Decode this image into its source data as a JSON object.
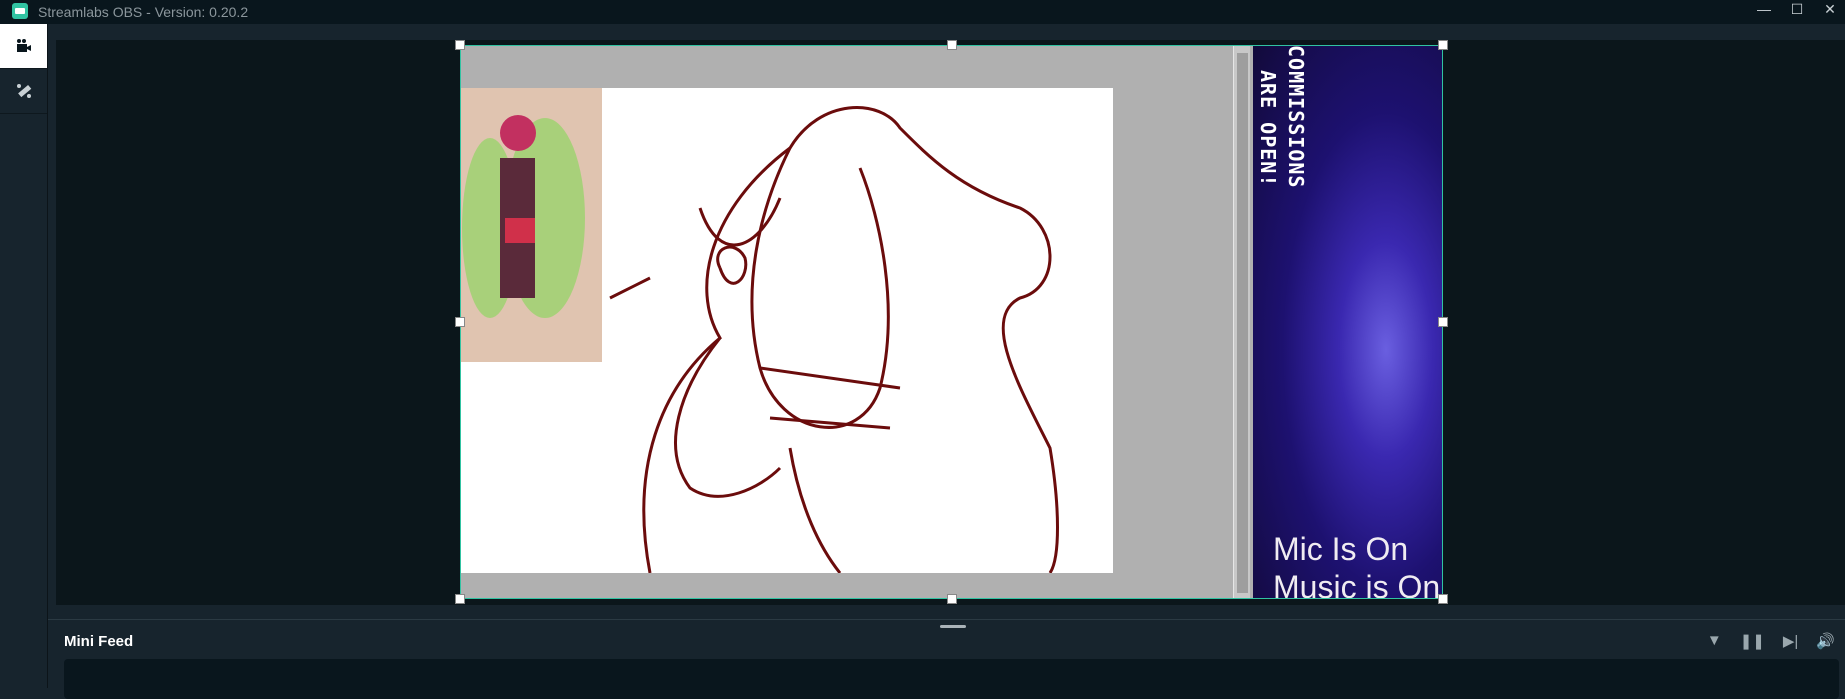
{
  "window": {
    "title": "Streamlabs OBS - Version: 0.20.2",
    "minimize": "—",
    "maximize": "☐",
    "close": "✕"
  },
  "sidebar": {
    "items": [
      {
        "name": "studio-icon",
        "active": true
      },
      {
        "name": "themes-icon",
        "active": false
      }
    ]
  },
  "preview": {
    "overlay_text_1": "COMMISSIONS",
    "overlay_text_2": "ARE OPEN!",
    "mic_status": "Mic Is On",
    "music_status": "Music is On"
  },
  "colors": {
    "accent": "#31c3a2",
    "background": "#17242d",
    "preview_bg": "#0b161b"
  },
  "mini_feed": {
    "title": "Mini Feed",
    "icons": [
      "filter-icon",
      "pause-icon",
      "skip-icon",
      "volume-icon"
    ]
  }
}
